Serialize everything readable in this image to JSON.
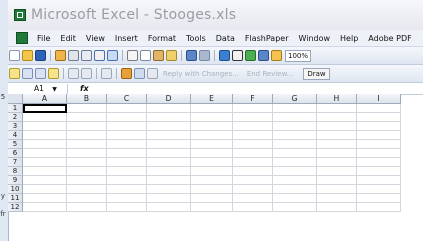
{
  "window": {
    "title": "Microsoft Excel - Stooges.xls"
  },
  "left_strip_marks": [
    "5",
    "",
    "",
    "",
    "",
    "",
    "",
    "",
    "y",
    "",
    "fr"
  ],
  "menu": [
    "File",
    "Edit",
    "View",
    "Insert",
    "Format",
    "Tools",
    "Data",
    "FlashPaper",
    "Window",
    "Help",
    "Adobe PDF"
  ],
  "toolbar": {
    "zoom": "100%"
  },
  "toolbar2": {
    "reply_changes": "Reply with Changes...",
    "end_review": "End Review...",
    "draw_label": "Draw"
  },
  "formula_bar": {
    "name_box": "A1",
    "fx": "fx",
    "value": ""
  },
  "columns": [
    "A",
    "B",
    "C",
    "D",
    "E",
    "F",
    "G",
    "H",
    "I"
  ],
  "rows": [
    "1",
    "2",
    "3",
    "4",
    "5",
    "6",
    "7",
    "8",
    "9",
    "10",
    "11",
    "12"
  ],
  "colors": {
    "excel_green": "#1f7a3a",
    "toolbar_bg": "#dfe6f1",
    "header_bg": "#dde3ec"
  }
}
